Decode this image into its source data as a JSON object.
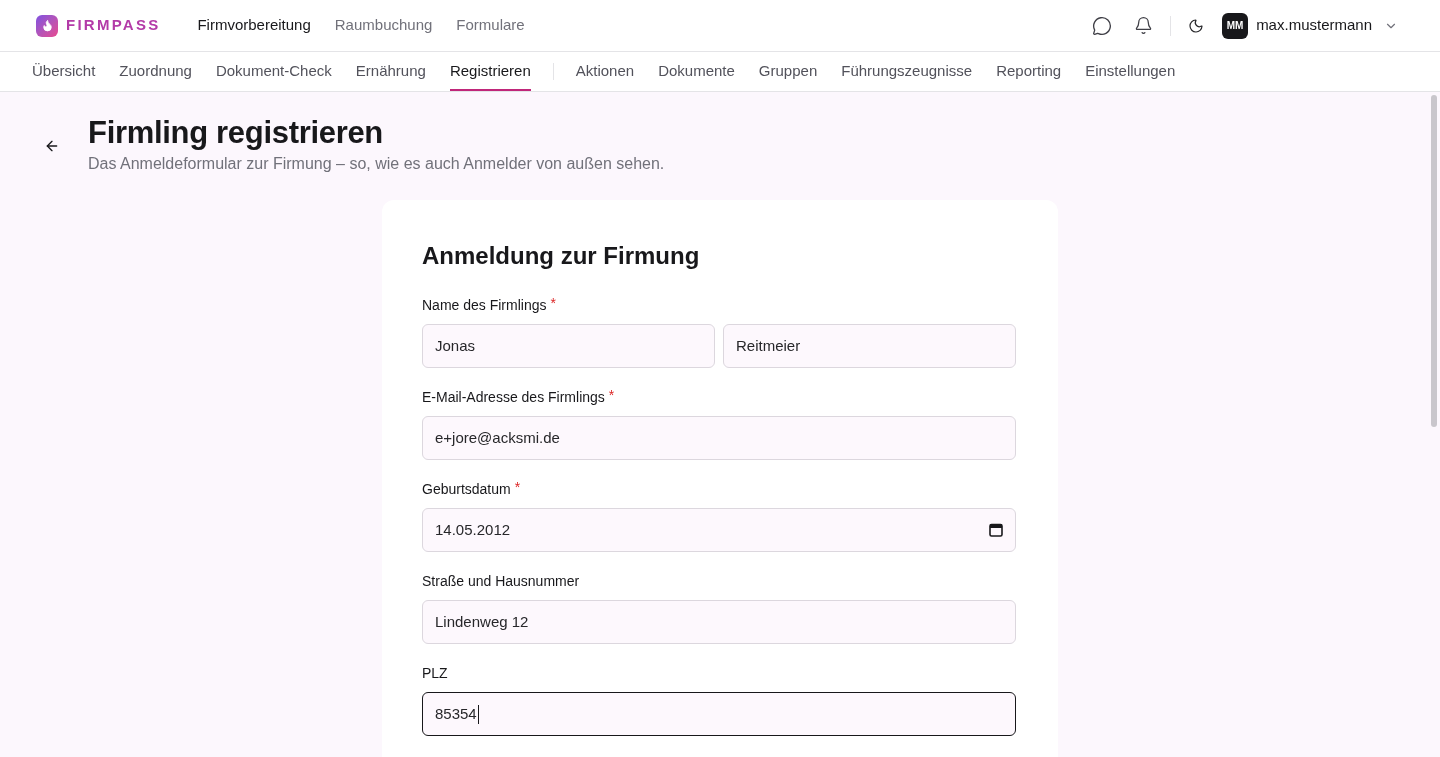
{
  "brand": {
    "name": "FIRMPASS"
  },
  "main_nav": [
    {
      "label": "Firmvorbereitung",
      "selected": true
    },
    {
      "label": "Raumbuchung",
      "selected": false
    },
    {
      "label": "Formulare",
      "selected": false
    }
  ],
  "user": {
    "initials": "MM",
    "name": "max.mustermann"
  },
  "sub_nav_groups": [
    {
      "items": [
        {
          "label": "Übersicht",
          "selected": false
        },
        {
          "label": "Zuordnung",
          "selected": false
        },
        {
          "label": "Dokument-Check",
          "selected": false
        },
        {
          "label": "Ernährung",
          "selected": false
        },
        {
          "label": "Registrieren",
          "selected": true
        }
      ]
    },
    {
      "items": [
        {
          "label": "Aktionen",
          "selected": false
        },
        {
          "label": "Dokumente",
          "selected": false
        },
        {
          "label": "Gruppen",
          "selected": false
        },
        {
          "label": "Führungszeugnisse",
          "selected": false
        },
        {
          "label": "Reporting",
          "selected": false
        },
        {
          "label": "Einstellungen",
          "selected": false
        }
      ]
    }
  ],
  "page": {
    "title": "Firmling registrieren",
    "subtitle": "Das Anmeldeformular zur Firmung – so, wie es auch Anmelder von außen sehen."
  },
  "form": {
    "title": "Anmeldung zur Firmung",
    "required_mark": "*",
    "fields": [
      {
        "label": "Name des Firmlings",
        "required": true,
        "kind": "text",
        "inputs": [
          {
            "value": "Jonas",
            "focused": false
          },
          {
            "value": "Reitmeier",
            "focused": false
          }
        ]
      },
      {
        "label": "E-Mail-Adresse des Firmlings",
        "required": true,
        "kind": "text",
        "inputs": [
          {
            "value": "e+jore@acksmi.de",
            "focused": false
          }
        ]
      },
      {
        "label": "Geburtsdatum",
        "required": true,
        "kind": "date",
        "inputs": [
          {
            "value": "14.05.2012",
            "focused": false
          }
        ]
      },
      {
        "label": "Straße und Hausnummer",
        "required": false,
        "kind": "text",
        "inputs": [
          {
            "value": "Lindenweg 12",
            "focused": false
          }
        ]
      },
      {
        "label": "PLZ",
        "required": false,
        "kind": "text",
        "inputs": [
          {
            "value": "85354",
            "focused": true
          }
        ]
      }
    ]
  }
}
